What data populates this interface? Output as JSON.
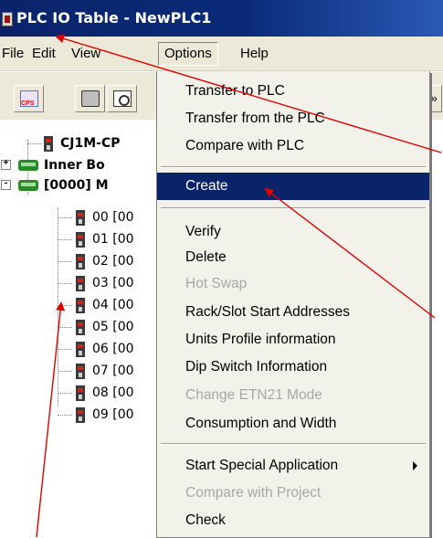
{
  "window": {
    "title": "PLC IO Table - NewPLC1"
  },
  "menubar": {
    "items": [
      {
        "label": "File"
      },
      {
        "label": "Edit"
      },
      {
        "label": "View"
      },
      {
        "label": "Options"
      },
      {
        "label": "Help"
      }
    ]
  },
  "toolbar": {
    "buttons": [
      {
        "icon": "cps-transfer-icon"
      },
      {
        "icon": "printer-icon"
      },
      {
        "icon": "print-preview-icon"
      }
    ]
  },
  "tree": {
    "roots": [
      {
        "label": "CJ1M-CP",
        "icon": "cpu-unit-icon"
      },
      {
        "label": "Inner Bo",
        "icon": "rack-icon",
        "expander": "+"
      },
      {
        "label": "[0000] M",
        "icon": "rack-icon",
        "expander": "-"
      }
    ],
    "slots": [
      {
        "label": "00 [00"
      },
      {
        "label": "01 [00"
      },
      {
        "label": "02 [00"
      },
      {
        "label": "03 [00"
      },
      {
        "label": "04 [00"
      },
      {
        "label": "05 [00"
      },
      {
        "label": "06 [00"
      },
      {
        "label": "07 [00"
      },
      {
        "label": "08 [00"
      },
      {
        "label": "09 [00"
      }
    ]
  },
  "options_menu": {
    "items": [
      {
        "label": "Transfer to PLC",
        "enabled": true
      },
      {
        "label": "Transfer from the PLC",
        "enabled": true
      },
      {
        "label": "Compare with PLC",
        "enabled": true
      },
      {
        "label": "Create",
        "enabled": true,
        "highlighted": true
      },
      {
        "label": "Verify",
        "enabled": true
      },
      {
        "label": "Delete",
        "enabled": true
      },
      {
        "label": "Hot Swap",
        "enabled": false
      },
      {
        "label": "Rack/Slot Start Addresses",
        "enabled": true
      },
      {
        "label": "Units Profile information",
        "enabled": true
      },
      {
        "label": "Dip Switch Information",
        "enabled": true
      },
      {
        "label": "Change ETN21 Mode",
        "enabled": false
      },
      {
        "label": "Consumption and Width",
        "enabled": true
      },
      {
        "label": "Start Special Application",
        "enabled": true,
        "submenu": true
      },
      {
        "label": "Compare with Project",
        "enabled": false
      },
      {
        "label": "Check",
        "enabled": true
      }
    ]
  },
  "colors": {
    "title_bar": "#0a246a",
    "menu_highlight": "#0a246a",
    "annotation_arrow": "#dd0000",
    "disabled_text": "#a8a8a8"
  }
}
